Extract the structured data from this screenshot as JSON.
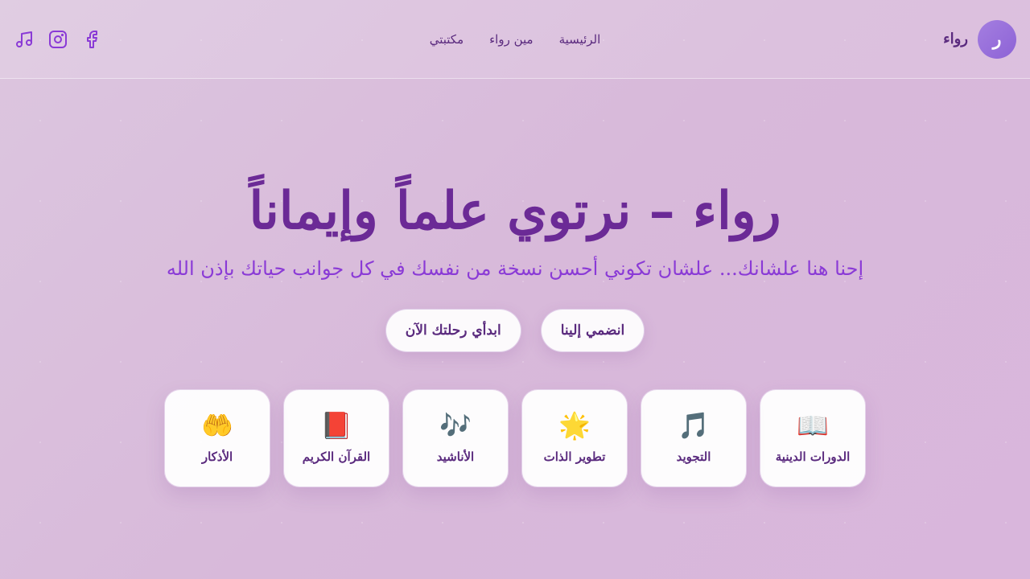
{
  "brand": {
    "logo_letter": "ر",
    "name": "رواء"
  },
  "nav": {
    "links": [
      {
        "label": "الرئيسية"
      },
      {
        "label": "مين رواء"
      },
      {
        "label": "مكتبتي"
      }
    ]
  },
  "socials": [
    {
      "icon": "facebook-icon"
    },
    {
      "icon": "instagram-icon"
    },
    {
      "icon": "music-icon"
    }
  ],
  "hero": {
    "title": "رواء – نرتوي علماً وإيماناً",
    "subtitle": "إحنا هنا علشانك... علشان تكوني أحسن نسخة من نفسك في كل جوانب حياتك بإذن الله",
    "cta_join": "انضمي إلينا",
    "cta_start": "ابدأي رحلتك الآن"
  },
  "cards": [
    {
      "icon": "📖",
      "label": "الدورات الدينية"
    },
    {
      "icon": "🎵",
      "label": "التجويد"
    },
    {
      "icon": "🌟",
      "label": "تطوير الذات"
    },
    {
      "icon": "🎶",
      "label": "الأناشيد"
    },
    {
      "icon": "📕",
      "label": "القرآن الكريم"
    },
    {
      "icon": "🤲",
      "label": "الأذكار"
    }
  ],
  "colors": {
    "accent": "#8a3ad6",
    "title": "#6b2a96",
    "text": "#5a2a7e"
  }
}
